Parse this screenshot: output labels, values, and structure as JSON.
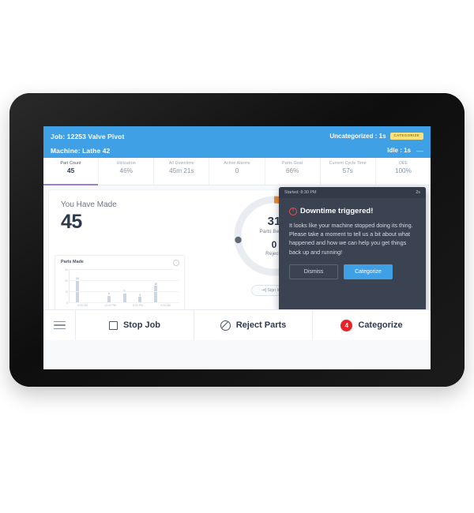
{
  "header": {
    "job": "Job: 12253 Valve Pivot",
    "machine": "Machine: Lathe 42",
    "uncategorized": "Uncategorized : 1s",
    "categorize_chip": "CATEGORIZE",
    "idle": "Idle : 1s",
    "idle_dash": "—"
  },
  "metrics": [
    {
      "label": "Part Count",
      "value": "45",
      "active": true
    },
    {
      "label": "Utilization",
      "value": "46%",
      "active": false
    },
    {
      "label": "All Downtime",
      "value": "45m 21s",
      "active": false
    },
    {
      "label": "Active Alarms",
      "value": "0",
      "active": false
    },
    {
      "label": "Parts Goal",
      "value": "66%",
      "active": false
    },
    {
      "label": "Current Cycle Time",
      "value": "57s",
      "active": false
    },
    {
      "label": "OEE",
      "value": "100%",
      "active": false
    }
  ],
  "produced": {
    "label": "You Have Made",
    "value": "45"
  },
  "chart_card": {
    "title": "Parts Made",
    "info_icon": "info-icon"
  },
  "chart_data": {
    "type": "bar",
    "title": "Parts Made",
    "xlabel": "",
    "ylabel": "",
    "ylim": [
      0,
      30
    ],
    "yticks": [
      "30",
      "20",
      "10",
      "0"
    ],
    "grid": true,
    "categories": [
      "4:00 AM",
      "",
      "12:00 PM",
      "",
      "8:00 PM",
      "",
      "4:00 AM"
    ],
    "xtick_labels": [
      "4:00 AM",
      "12:00 PM",
      "8:00 PM",
      "4:00 AM"
    ],
    "series": [
      {
        "name": "Parts Made",
        "color": "#cdd5e0",
        "values": [
          20,
          0,
          6,
          8,
          5,
          15,
          0
        ],
        "labels": [
          "20",
          "",
          "6",
          "8",
          "5",
          "15",
          ""
        ]
      },
      {
        "name": "Rejects",
        "color": "#f08b8b",
        "values": [
          0,
          0,
          1,
          1,
          0,
          0,
          0
        ],
        "labels": [
          "",
          "",
          "",
          "",
          "",
          "",
          ""
        ]
      }
    ]
  },
  "gauge": {
    "parts_behind_value": "31",
    "parts_behind_label": "Parts Behind",
    "rejects_value": "0",
    "rejects_label": "Rejects",
    "track_color": "#e9edf2",
    "arc_color": "#ef8b33",
    "dot_color": "#5f6a79",
    "arc_percent": 46
  },
  "sign_in": {
    "label": "Sign In Now",
    "icon": "sign-in-icon"
  },
  "modal": {
    "started": "Started: 8:30 PM",
    "elapsed": "2s",
    "title": "Downtime triggered!",
    "alert_icon": "alert-circle-icon",
    "body": "It looks like your machine stopped doing its thing. Please take a moment to tell us a bit about what happened and how we can help you get things back up and running!",
    "dismiss": "Dismiss",
    "categorize": "Categorize",
    "accent": "#3fa0e5"
  },
  "bottom_bar": {
    "menu_icon": "hamburger-menu-icon",
    "stop_job": "Stop Job",
    "stop_job_icon": "square-icon",
    "reject_parts": "Reject Parts",
    "reject_parts_icon": "ban-icon",
    "categorize": "Categorize",
    "categorize_count": "4",
    "badge_color": "#e3242b"
  }
}
